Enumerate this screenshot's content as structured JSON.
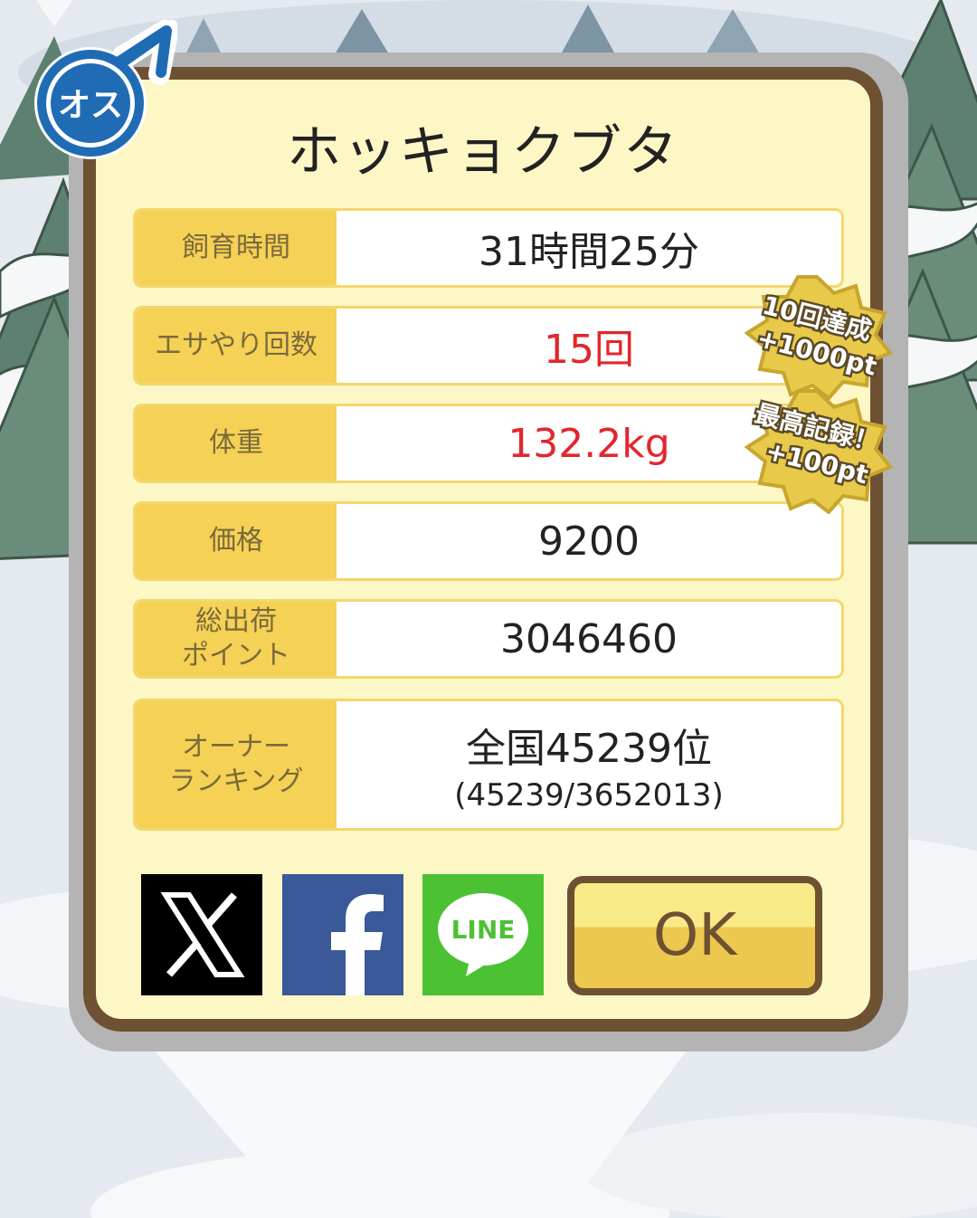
{
  "title": "ホッキョクブタ",
  "gender": {
    "label": "オス",
    "icon": "male-symbol-icon",
    "color": "#1f6cb5"
  },
  "rows": [
    {
      "label": "飼育時間",
      "value": "31時間25分",
      "value_color": "#222222"
    },
    {
      "label": "エサやり回数",
      "value": "15回",
      "value_color": "#e3262c"
    },
    {
      "label": "体重",
      "value": "132.2kg",
      "value_color": "#e3262c"
    },
    {
      "label": "価格",
      "value": "9200",
      "value_color": "#222222"
    },
    {
      "label": "総出荷\nポイント",
      "value": "3046460",
      "value_color": "#222222"
    },
    {
      "label": "オーナー\nランキング",
      "value": "全国45239位",
      "sub_value": "(45239/3652013)",
      "value_color": "#222222"
    }
  ],
  "badges": [
    {
      "line1": "10回達成",
      "line2": "+1000pt"
    },
    {
      "line1": "最高記録！",
      "line2": "+100pt"
    }
  ],
  "share": {
    "x_icon": "x-logo-icon",
    "facebook_icon": "facebook-logo-icon",
    "line_icon": "line-logo-icon",
    "line_text": "LINE"
  },
  "ok_label": "OK",
  "colors": {
    "frame": "#6e5032",
    "panel": "#fdf7c6",
    "label_bg": "#f5d155",
    "highlight_red": "#e3262c"
  }
}
